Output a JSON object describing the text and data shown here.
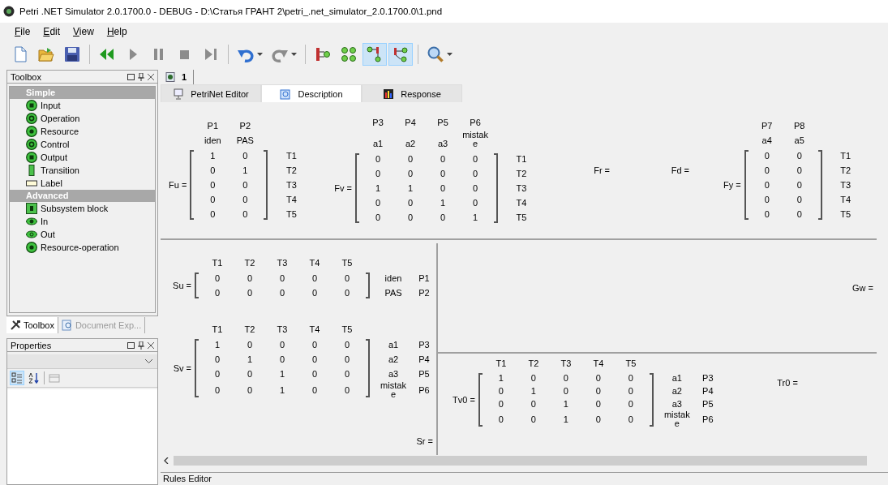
{
  "window": {
    "title": "Petri .NET Simulator 2.0.1700.0 - DEBUG - D:\\Статья ГРАНТ 2\\petri_.net_simulator_2.0.1700.0\\1.pnd"
  },
  "menu": [
    "File",
    "Edit",
    "View",
    "Help"
  ],
  "toolbar": [
    [
      {
        "kind": "new",
        "on": false,
        "disabled": false,
        "dropdown": false
      },
      {
        "kind": "open",
        "on": false,
        "disabled": false,
        "dropdown": false
      },
      {
        "kind": "save",
        "on": false,
        "disabled": false,
        "dropdown": false
      }
    ],
    [
      {
        "kind": "rewind",
        "on": false,
        "disabled": false,
        "dropdown": false
      },
      {
        "kind": "play",
        "on": false,
        "disabled": true,
        "dropdown": false
      },
      {
        "kind": "pause",
        "on": false,
        "disabled": true,
        "dropdown": false
      },
      {
        "kind": "stop",
        "on": false,
        "disabled": true,
        "dropdown": false
      },
      {
        "kind": "step",
        "on": false,
        "disabled": true,
        "dropdown": false
      }
    ],
    [
      {
        "kind": "undo",
        "on": false,
        "disabled": false,
        "dropdown": true
      },
      {
        "kind": "redo",
        "on": false,
        "disabled": true,
        "dropdown": true
      }
    ],
    [
      {
        "kind": "net-arc",
        "on": false,
        "disabled": false,
        "dropdown": false
      },
      {
        "kind": "net-cycle",
        "on": false,
        "disabled": false,
        "dropdown": false
      },
      {
        "kind": "net-fork",
        "on": true,
        "disabled": false,
        "dropdown": false
      },
      {
        "kind": "net-branch",
        "on": true,
        "disabled": false,
        "dropdown": false
      }
    ],
    [
      {
        "kind": "zoom",
        "on": false,
        "disabled": false,
        "dropdown": true
      }
    ]
  ],
  "toolbox": {
    "title": "Toolbox",
    "sections": [
      {
        "label": "Simple",
        "items": [
          {
            "label": "Input",
            "kind": "input"
          },
          {
            "label": "Operation",
            "kind": "operation"
          },
          {
            "label": "Resource",
            "kind": "resource"
          },
          {
            "label": "Control",
            "kind": "control"
          },
          {
            "label": "Output",
            "kind": "output"
          },
          {
            "label": "Transition",
            "kind": "transition"
          },
          {
            "label": "Label",
            "kind": "label"
          }
        ]
      },
      {
        "label": "Advanced",
        "items": [
          {
            "label": "Subsystem block",
            "kind": "subsystem"
          },
          {
            "label": "In",
            "kind": "in"
          },
          {
            "label": "Out",
            "kind": "out"
          },
          {
            "label": "Resource-operation",
            "kind": "resource-operation"
          }
        ]
      }
    ]
  },
  "panel_tabs": [
    {
      "label": "Toolbox",
      "selected": true
    },
    {
      "label": "Document Exp...",
      "selected": false
    }
  ],
  "properties": {
    "title": "Properties"
  },
  "document_tab": {
    "label": "1"
  },
  "view_tabs": [
    {
      "label": "PetriNet Editor",
      "selected": false
    },
    {
      "label": "Description",
      "selected": true
    },
    {
      "label": "Response",
      "selected": false
    }
  ],
  "top_matrices": [
    {
      "label": "Fu =",
      "headers": [
        [
          "P1",
          "P2"
        ],
        [
          "iden",
          "PAS"
        ]
      ],
      "rows": [
        {
          "values": [
            "1",
            "0"
          ],
          "side": [
            "T1"
          ]
        },
        {
          "values": [
            "0",
            "1"
          ],
          "side": [
            "T2"
          ]
        },
        {
          "values": [
            "0",
            "0"
          ],
          "side": [
            "T3"
          ]
        },
        {
          "values": [
            "0",
            "0"
          ],
          "side": [
            "T4"
          ]
        },
        {
          "values": [
            "0",
            "0"
          ],
          "side": [
            "T5"
          ]
        }
      ]
    },
    {
      "label": "Fv =",
      "headers": [
        [
          "P3",
          "P4",
          "P5",
          "P6"
        ],
        [
          "a1",
          "a2",
          "a3",
          "mistake"
        ]
      ],
      "rows": [
        {
          "values": [
            "0",
            "0",
            "0",
            "0"
          ],
          "side": [
            "T1"
          ]
        },
        {
          "values": [
            "0",
            "0",
            "0",
            "0"
          ],
          "side": [
            "T2"
          ]
        },
        {
          "values": [
            "1",
            "1",
            "0",
            "0"
          ],
          "side": [
            "T3"
          ]
        },
        {
          "values": [
            "0",
            "0",
            "1",
            "0"
          ],
          "side": [
            "T4"
          ]
        },
        {
          "values": [
            "0",
            "0",
            "0",
            "1"
          ],
          "side": [
            "T5"
          ]
        }
      ]
    },
    {
      "label": "Fr ="
    },
    {
      "label": "Fd ="
    },
    {
      "label": "Fy =",
      "headers": [
        [
          "P7",
          "P8"
        ],
        [
          "a4",
          "a5"
        ]
      ],
      "rows": [
        {
          "values": [
            "0",
            "0"
          ],
          "side": [
            "T1"
          ]
        },
        {
          "values": [
            "0",
            "0"
          ],
          "side": [
            "T2"
          ]
        },
        {
          "values": [
            "0",
            "0"
          ],
          "side": [
            "T3"
          ]
        },
        {
          "values": [
            "0",
            "0"
          ],
          "side": [
            "T4"
          ]
        },
        {
          "values": [
            "0",
            "0"
          ],
          "side": [
            "T5"
          ]
        }
      ]
    }
  ],
  "left_matrices": [
    {
      "label": "Su =",
      "headers": [
        [
          "T1",
          "T2",
          "T3",
          "T4",
          "T5"
        ]
      ],
      "rows": [
        {
          "values": [
            "0",
            "0",
            "0",
            "0",
            "0"
          ],
          "side": [
            "iden",
            "P1"
          ]
        },
        {
          "values": [
            "0",
            "0",
            "0",
            "0",
            "0"
          ],
          "side": [
            "PAS",
            "P2"
          ]
        }
      ]
    },
    {
      "label": "Sv =",
      "headers": [
        [
          "T1",
          "T2",
          "T3",
          "T4",
          "T5"
        ]
      ],
      "rows": [
        {
          "values": [
            "1",
            "0",
            "0",
            "0",
            "0"
          ],
          "side": [
            "a1",
            "P3"
          ]
        },
        {
          "values": [
            "0",
            "1",
            "0",
            "0",
            "0"
          ],
          "side": [
            "a2",
            "P4"
          ]
        },
        {
          "values": [
            "0",
            "0",
            "1",
            "0",
            "0"
          ],
          "side": [
            "a3",
            "P5"
          ]
        },
        {
          "values": [
            "0",
            "0",
            "1",
            "0",
            "0"
          ],
          "side": [
            "mistake",
            "P6"
          ]
        }
      ]
    },
    {
      "label": "Sr ="
    }
  ],
  "right_top_matrices": [
    {
      "label": "Gw ="
    }
  ],
  "right_bottom_matrices": [
    {
      "label": "Tv0 =",
      "headers": [
        [
          "T1",
          "T2",
          "T3",
          "T4",
          "T5"
        ]
      ],
      "rows": [
        {
          "values": [
            "1",
            "0",
            "0",
            "0",
            "0"
          ],
          "side": [
            "a1",
            "P3"
          ]
        },
        {
          "values": [
            "0",
            "1",
            "0",
            "0",
            "0"
          ],
          "side": [
            "a2",
            "P4"
          ]
        },
        {
          "values": [
            "0",
            "0",
            "1",
            "0",
            "0"
          ],
          "side": [
            "a3",
            "P5"
          ]
        },
        {
          "values": [
            "0",
            "0",
            "1",
            "0",
            "0"
          ],
          "side": [
            "mistake",
            "P6"
          ]
        }
      ]
    },
    {
      "label": "Tr0 ="
    }
  ],
  "bottom_panel": {
    "title": "Rules Editor"
  }
}
